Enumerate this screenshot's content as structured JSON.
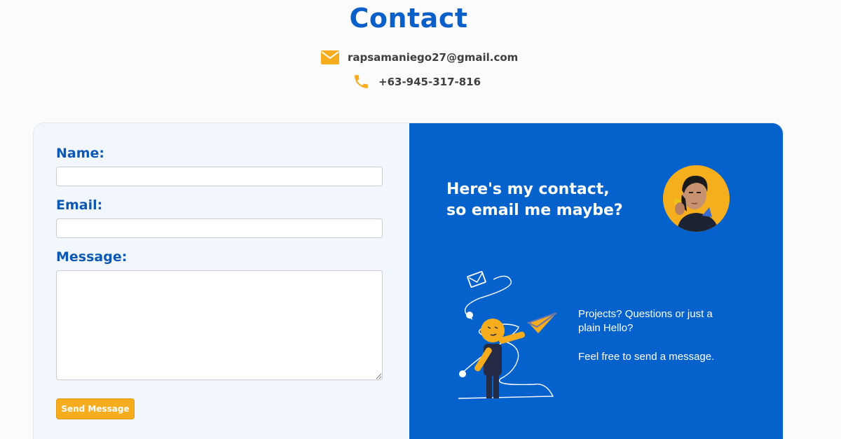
{
  "header": {
    "title": "Contact",
    "email": "rapsamaniego27@gmail.com",
    "phone": "+63-945-317-816"
  },
  "form": {
    "name_label": "Name:",
    "name_value": "",
    "email_label": "Email:",
    "email_value": "",
    "message_label": "Message:",
    "message_value": "",
    "submit_label": "Send Message"
  },
  "info": {
    "heading_line1": "Here's my contact,",
    "heading_line2": "so email me maybe?",
    "question": "Projects? Questions or just a plain Hello?",
    "invite": "Feel free to send a message."
  },
  "icons": {
    "email": "envelope-icon",
    "phone": "phone-icon"
  },
  "colors": {
    "accent_blue": "#0562cc",
    "title_blue": "#0a5fc8",
    "accent_yellow": "#f5ad1e",
    "form_bg": "#f1f7fd"
  }
}
